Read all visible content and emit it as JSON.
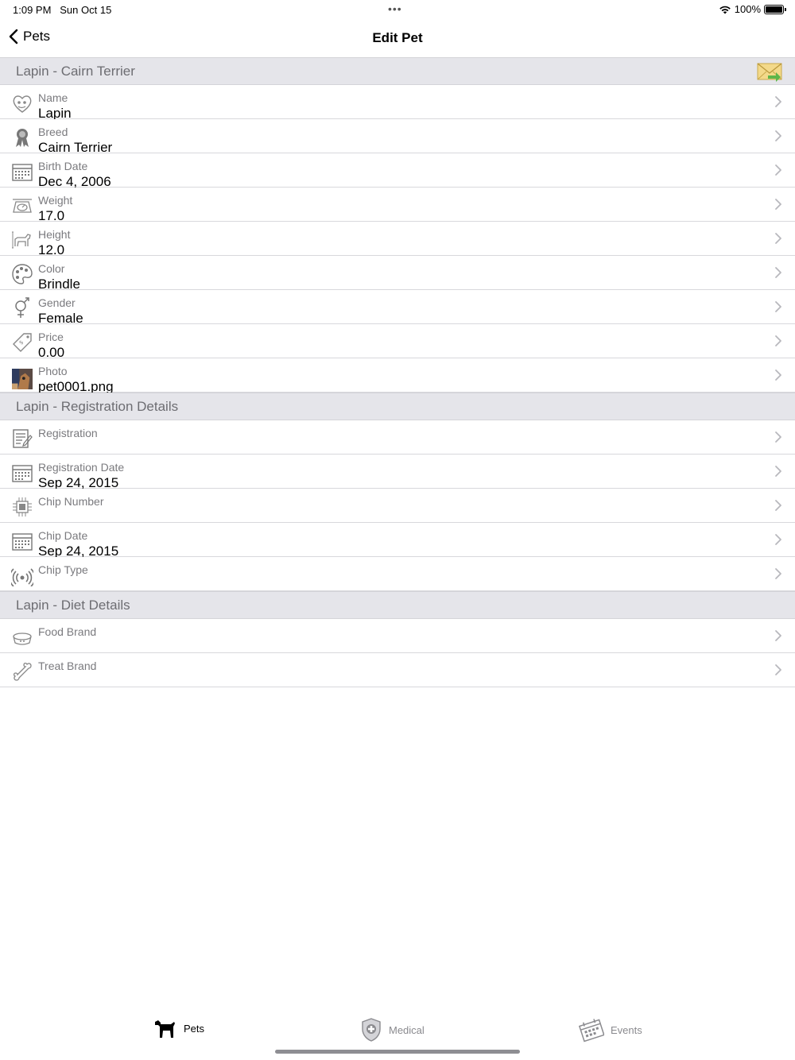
{
  "status_bar": {
    "time": "1:09 PM",
    "date": "Sun Oct 15",
    "battery": "100%"
  },
  "nav": {
    "back_label": "Pets",
    "title": "Edit Pet"
  },
  "sections": [
    {
      "title": "Lapin - Cairn Terrier",
      "rows": [
        {
          "label": "Name",
          "value": "Lapin",
          "icon": "pet-heart-icon"
        },
        {
          "label": "Breed",
          "value": "Cairn Terrier",
          "icon": "award-ribbon-icon"
        },
        {
          "label": "Birth Date",
          "value": "Dec 4, 2006",
          "icon": "calendar-icon"
        },
        {
          "label": "Weight",
          "value": "17.0",
          "icon": "scale-icon"
        },
        {
          "label": "Height",
          "value": "12.0",
          "icon": "dog-height-icon"
        },
        {
          "label": "Color",
          "value": "Brindle",
          "icon": "palette-icon"
        },
        {
          "label": "Gender",
          "value": "Female",
          "icon": "gender-icon"
        },
        {
          "label": "Price",
          "value": "0.00",
          "icon": "price-tag-icon"
        },
        {
          "label": "Photo",
          "value": "pet0001.png",
          "icon": "photo-thumbnail"
        }
      ]
    },
    {
      "title": "Lapin - Registration Details",
      "rows": [
        {
          "label": "Registration",
          "value": "",
          "icon": "document-icon"
        },
        {
          "label": "Registration Date",
          "value": "Sep 24, 2015",
          "icon": "calendar-icon"
        },
        {
          "label": "Chip Number",
          "value": "",
          "icon": "microchip-icon"
        },
        {
          "label": "Chip Date",
          "value": "Sep 24, 2015",
          "icon": "calendar-icon"
        },
        {
          "label": "Chip Type",
          "value": "",
          "icon": "signal-icon"
        }
      ]
    },
    {
      "title": "Lapin - Diet Details",
      "rows": [
        {
          "label": "Food Brand",
          "value": "",
          "icon": "food-bowl-icon"
        },
        {
          "label": "Treat Brand",
          "value": "",
          "icon": "bone-icon"
        }
      ]
    }
  ],
  "tabs": [
    {
      "label": "Pets",
      "icon": "dog-icon",
      "selected": true
    },
    {
      "label": "Medical",
      "icon": "medical-shield-icon",
      "selected": false
    },
    {
      "label": "Events",
      "icon": "events-calendar-icon",
      "selected": false
    }
  ]
}
